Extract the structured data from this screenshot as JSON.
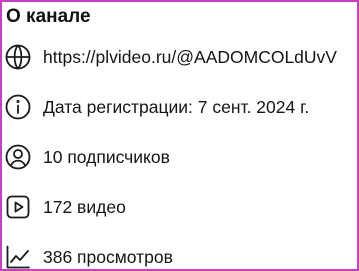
{
  "about": {
    "title": "О канале",
    "rows": [
      {
        "icon": "globe-icon",
        "text": "https://plvideo.ru/@AADOMCOLdUvV"
      },
      {
        "icon": "info-icon",
        "text": "Дата регистрации: 7 сент. 2024 г."
      },
      {
        "icon": "user-icon",
        "text": "10 подписчиков"
      },
      {
        "icon": "video-icon",
        "text": "172 видео"
      },
      {
        "icon": "chart-line-icon",
        "text": "386 просмотров"
      }
    ]
  },
  "colors": {
    "border": "#c53fc2",
    "text": "#151515"
  }
}
